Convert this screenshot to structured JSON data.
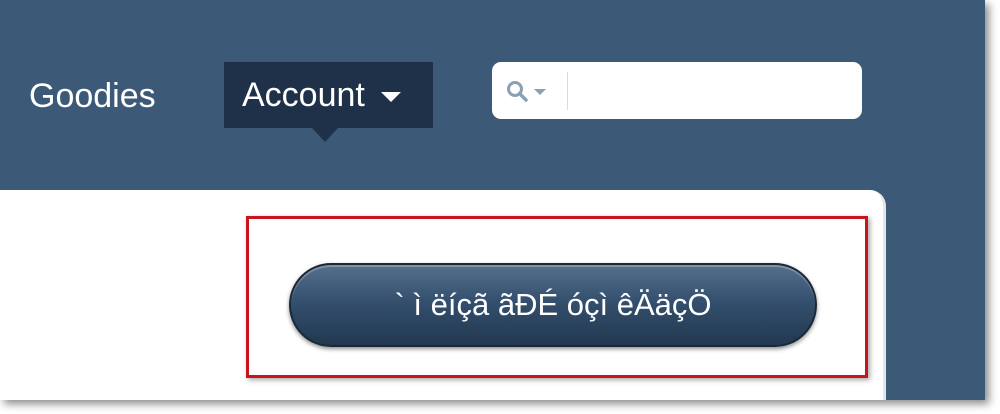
{
  "nav": {
    "goodies_label": "Goodies",
    "account_label": "Account"
  },
  "search": {
    "value": "",
    "placeholder": ""
  },
  "panel": {
    "button_label": "` ì ëíçã ãÐÉ óçì êÄäçÖ﻿"
  },
  "icons": {
    "search": "search-icon",
    "account_caret": "chevron-down-icon",
    "search_caret": "chevron-down-icon"
  },
  "colors": {
    "header_bg": "#3c5a78",
    "account_bg": "#1f3148",
    "highlight_border": "#c8141c",
    "button_top": "#55708c",
    "button_bottom": "#22384f"
  }
}
